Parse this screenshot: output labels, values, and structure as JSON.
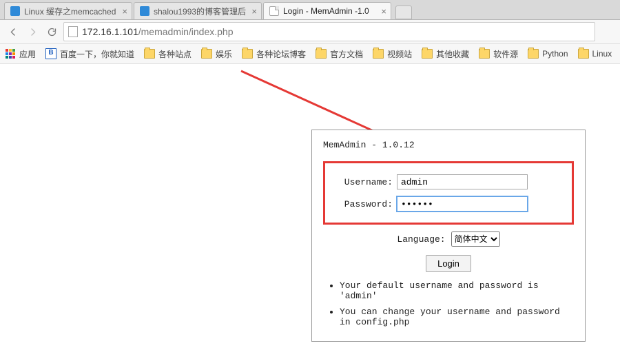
{
  "tabs": [
    {
      "title": "Linux 缓存之memcached",
      "active": false,
      "favicon": "blue"
    },
    {
      "title": "shalou1993的博客管理后",
      "active": false,
      "favicon": "blue"
    },
    {
      "title": "Login - MemAdmin -1.0",
      "active": true,
      "favicon": "doc"
    }
  ],
  "omnibox": {
    "host": "172.16.1.101",
    "path": "/memadmin/index.php"
  },
  "bookmarks": {
    "apps_label": "应用",
    "items": [
      {
        "kind": "baidu",
        "label": "百度一下，你就知道"
      },
      {
        "kind": "folder",
        "label": "各种站点"
      },
      {
        "kind": "folder",
        "label": "娱乐"
      },
      {
        "kind": "folder",
        "label": "各种论坛博客"
      },
      {
        "kind": "folder",
        "label": "官方文档"
      },
      {
        "kind": "folder",
        "label": "视频站"
      },
      {
        "kind": "folder",
        "label": "其他收藏"
      },
      {
        "kind": "folder",
        "label": "软件源"
      },
      {
        "kind": "folder",
        "label": "Python"
      },
      {
        "kind": "folder",
        "label": "Linux"
      }
    ]
  },
  "login": {
    "title": "MemAdmin - 1.0.12",
    "username_label": "Username:",
    "username_value": "admin",
    "password_label": "Password:",
    "password_value": "••••••",
    "language_label": "Language:",
    "language_selected": "简体中文",
    "button": "Login",
    "notes": [
      "Your default username and password is 'admin'",
      "You can change your username and password in config.php"
    ]
  }
}
